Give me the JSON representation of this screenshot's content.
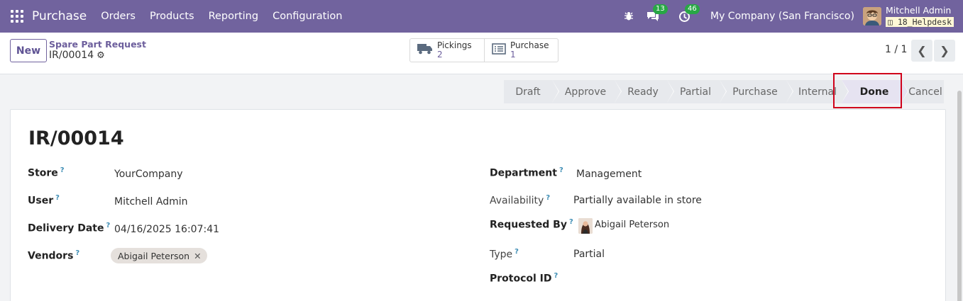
{
  "navbar": {
    "app_name": "Purchase",
    "menu": [
      "Orders",
      "Products",
      "Reporting",
      "Configuration"
    ],
    "messages_count": "13",
    "activities_count": "46",
    "company": "My Company (San Francisco)",
    "user_name": "Mitchell Admin",
    "database": "18_Helpdesk"
  },
  "control": {
    "new_label": "New",
    "breadcrumb_parent": "Spare Part Request",
    "breadcrumb_current": "IR/00014",
    "smart_buttons": [
      {
        "label": "Pickings",
        "value": "2",
        "icon": "truck-icon"
      },
      {
        "label": "Purchase",
        "value": "1",
        "icon": "list-icon"
      }
    ],
    "pager": "1 / 1"
  },
  "status": {
    "stages": [
      "Draft",
      "Approve",
      "Ready",
      "Partial",
      "Purchase",
      "Internal",
      "Done",
      "Cancel"
    ],
    "active": "Done"
  },
  "form": {
    "title": "IR/00014",
    "left": {
      "store_label": "Store",
      "store_value": "YourCompany",
      "user_label": "User",
      "user_value": "Mitchell Admin",
      "delivery_label": "Delivery Date",
      "delivery_value": "04/16/2025 16:07:41",
      "vendors_label": "Vendors",
      "vendor_tag": "Abigail Peterson"
    },
    "right": {
      "department_label": "Department",
      "department_value": "Management",
      "availability_label": "Availability",
      "availability_value": "Partially available in store",
      "requested_label": "Requested By",
      "requested_value": "Abigail Peterson",
      "type_label": "Type",
      "type_value": "Partial",
      "protocol_label": "Protocol ID"
    },
    "help_mark": "?"
  },
  "colors": {
    "navbar": "#71639e",
    "accent": "#6c5e9c",
    "highlight": "#d0021b",
    "badge": "#28a745"
  }
}
